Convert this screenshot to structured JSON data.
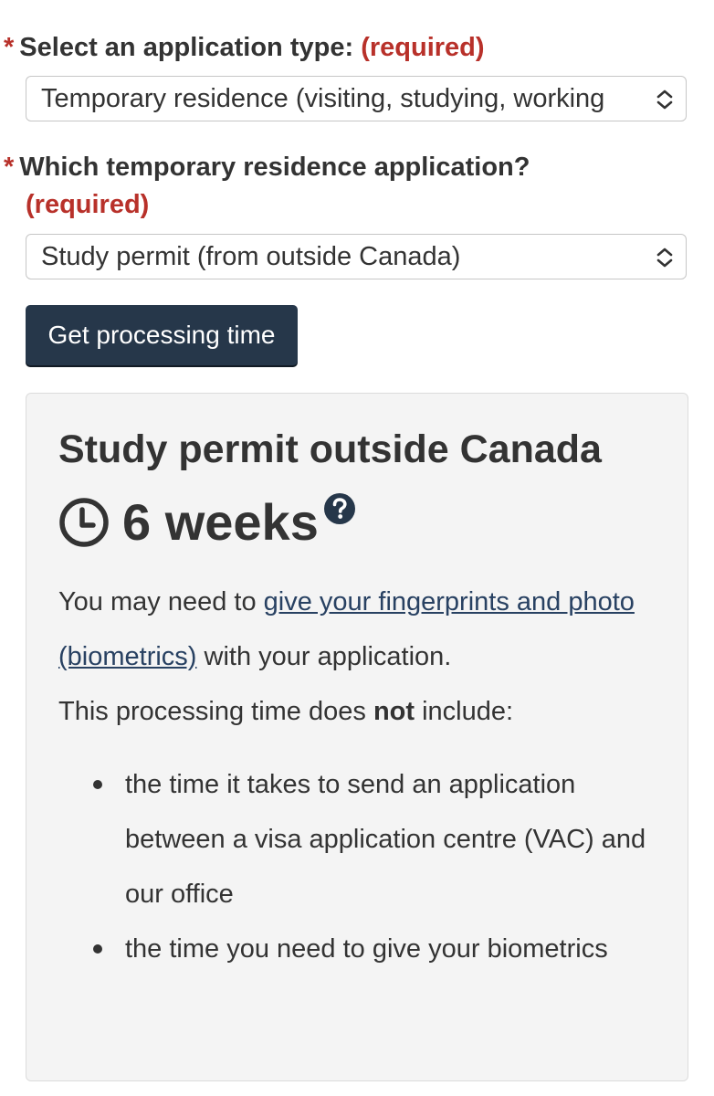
{
  "form": {
    "application_type": {
      "asterisk": "*",
      "label": "Select an application type:",
      "required": "(required)",
      "selected": "Temporary residence (visiting, studying, working"
    },
    "temp_residence_app": {
      "asterisk": "*",
      "label": "Which temporary residence application?",
      "required": "(required)",
      "selected": "Study permit (from outside Canada)"
    },
    "submit_label": "Get processing time"
  },
  "result": {
    "title": "Study permit outside Canada",
    "duration": "6 weeks",
    "intro_before_link": "You may need to ",
    "link_text": "give your fingerprints and photo (biometrics)",
    "intro_after_link": " with your application.",
    "note_before_bold": "This processing time does ",
    "note_bold": "not",
    "note_after_bold": " include:",
    "bullets": [
      "the time it takes to send an application between a visa application centre (VAC) and our office",
      "the time you need to give your biometrics"
    ]
  },
  "icons": {
    "clock": "clock-icon",
    "help": "question-circle-icon",
    "select_arrows": "chevron-up-down-icon"
  },
  "colors": {
    "required_red": "#b8312a",
    "button_bg": "#26374a",
    "link": "#284162",
    "panel_bg": "#f4f4f4"
  }
}
